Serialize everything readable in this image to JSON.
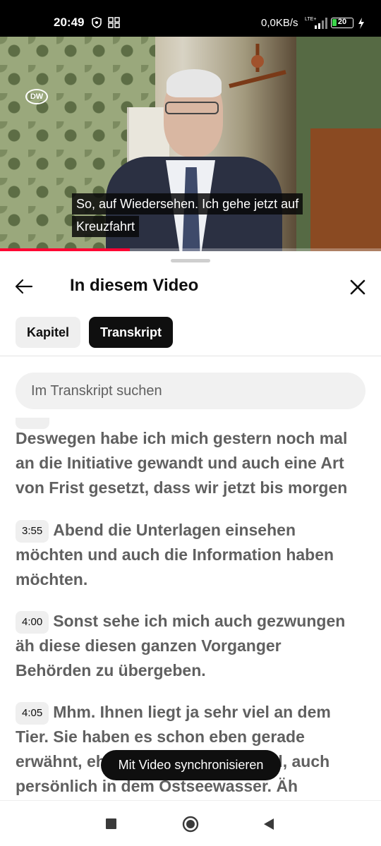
{
  "status_bar": {
    "time": "20:49",
    "network_speed": "0,0KB/s",
    "network_type": "LTE+",
    "battery_level": "20"
  },
  "video": {
    "channel_logo": "DW",
    "subtitle_lines": [
      "So, auf Wiedersehen. Ich gehe jetzt auf",
      "Kreuzfahrt"
    ],
    "progress_fraction": 0.34
  },
  "sheet": {
    "title": "In diesem Video",
    "tabs": [
      {
        "label": "Kapitel",
        "active": false
      },
      {
        "label": "Transkript",
        "active": true
      }
    ],
    "search_placeholder": "Im Transkript suchen"
  },
  "transcript": {
    "segments": [
      {
        "timestamp": "",
        "text": "Deswegen habe ich mich gestern noch mal an die Initiative gewandt und auch eine Art von Frist gesetzt, dass wir jetzt bis morgen"
      },
      {
        "timestamp": "3:55",
        "text": "Abend die Unterlagen einsehen möchten und auch die Information haben möchten."
      },
      {
        "timestamp": "4:00",
        "text": "Sonst sehe ich mich auch gezwungen äh diese diesen ganzen Vorganger Behörden zu übergeben."
      },
      {
        "timestamp": "4:05",
        "text": "Mhm. Ihnen liegt ja sehr viel an dem Tier. Sie haben es schon eben gerade erwähnt, eh sie haben zusam Wahl, auch persönlich in dem Ostseewasser. Äh"
      }
    ]
  },
  "toast": {
    "label": "Mit Video synchronisieren"
  },
  "icons": {
    "back": "arrow-left-icon",
    "close": "close-icon",
    "nav_recents": "square-icon",
    "nav_home": "circle-icon",
    "nav_back": "triangle-back-icon"
  },
  "colors": {
    "accent": "#ff0033",
    "chip_active_bg": "#0f0f0f",
    "chip_bg": "#efefef",
    "text_secondary": "#606060"
  }
}
